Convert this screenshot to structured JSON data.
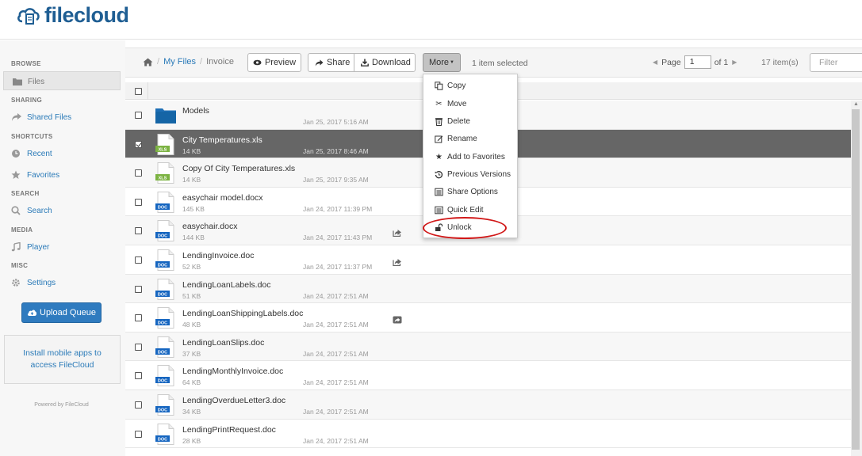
{
  "app": {
    "logo": "filecloud"
  },
  "sidebar": {
    "sections": {
      "browse": "BROWSE",
      "sharing": "SHARING",
      "shortcuts": "SHORTCUTS",
      "search": "SEARCH",
      "media": "MEDIA",
      "misc": "MISC"
    },
    "items": {
      "files": "Files",
      "shared_files": "Shared Files",
      "recent": "Recent",
      "favorites": "Favorites",
      "search": "Search",
      "player": "Player",
      "settings": "Settings"
    },
    "upload_queue": "Upload Queue",
    "mobile_apps": "Install mobile apps to access FileCloud",
    "powered_by": "Powered by FileCloud"
  },
  "toolbar": {
    "breadcrumb": {
      "root": "My Files",
      "current": "Invoice"
    },
    "preview": "Preview",
    "share": "Share",
    "download": "Download",
    "more": "More",
    "selection_info": "1 item selected",
    "page_label": "Page",
    "page_value": "1",
    "page_of": "of 1",
    "item_count": "17 item(s)",
    "filter_placeholder": "Filter"
  },
  "more_menu": {
    "copy": "Copy",
    "move": "Move",
    "delete": "Delete",
    "rename": "Rename",
    "add_to_favorites": "Add to Favorites",
    "previous_versions": "Previous Versions",
    "share_options": "Share Options",
    "quick_edit": "Quick Edit",
    "unlock": "Unlock"
  },
  "files": [
    {
      "name": "Models",
      "size": "",
      "date": "Jan 25, 2017 5:16 AM",
      "type": "folder"
    },
    {
      "name": "City Temperatures.xls",
      "size": "14 KB",
      "date": "Jan 25, 2017 8:46 AM",
      "type": "xls",
      "icon_label": "XLS"
    },
    {
      "name": "Copy Of City Temperatures.xls",
      "size": "14 KB",
      "date": "Jan 25, 2017 9:35 AM",
      "type": "xls",
      "icon_label": "XLS"
    },
    {
      "name": "easychair model.docx",
      "size": "145 KB",
      "date": "Jan 24, 2017 11:39 PM",
      "type": "doc",
      "icon_label": "DOC"
    },
    {
      "name": "easychair.docx",
      "size": "144 KB",
      "date": "Jan 24, 2017 11:43 PM",
      "type": "doc",
      "icon_label": "DOC"
    },
    {
      "name": "LendingInvoice.doc",
      "size": "52 KB",
      "date": "Jan 24, 2017 11:37 PM",
      "type": "doc",
      "icon_label": "DOC"
    },
    {
      "name": "LendingLoanLabels.doc",
      "size": "51 KB",
      "date": "Jan 24, 2017 2:51 AM",
      "type": "doc",
      "icon_label": "DOC"
    },
    {
      "name": "LendingLoanShippingLabels.doc",
      "size": "48 KB",
      "date": "Jan 24, 2017 2:51 AM",
      "type": "doc",
      "icon_label": "DOC"
    },
    {
      "name": "LendingLoanSlips.doc",
      "size": "37 KB",
      "date": "Jan 24, 2017 2:51 AM",
      "type": "doc",
      "icon_label": "DOC"
    },
    {
      "name": "LendingMonthlyInvoice.doc",
      "size": "64 KB",
      "date": "Jan 24, 2017 2:51 AM",
      "type": "doc",
      "icon_label": "DOC"
    },
    {
      "name": "LendingOverdueLetter3.doc",
      "size": "34 KB",
      "date": "Jan 24, 2017 2:51 AM",
      "type": "doc",
      "icon_label": "DOC"
    },
    {
      "name": "LendingPrintRequest.doc",
      "size": "28 KB",
      "date": "Jan 24, 2017 2:51 AM",
      "type": "doc",
      "icon_label": "DOC"
    }
  ],
  "colors": {
    "brand": "#1f5e93",
    "link": "#2a7ab8",
    "selected_row": "#666666",
    "xls": "#7cb342",
    "doc": "#1565c0",
    "highlight": "#d11818"
  }
}
